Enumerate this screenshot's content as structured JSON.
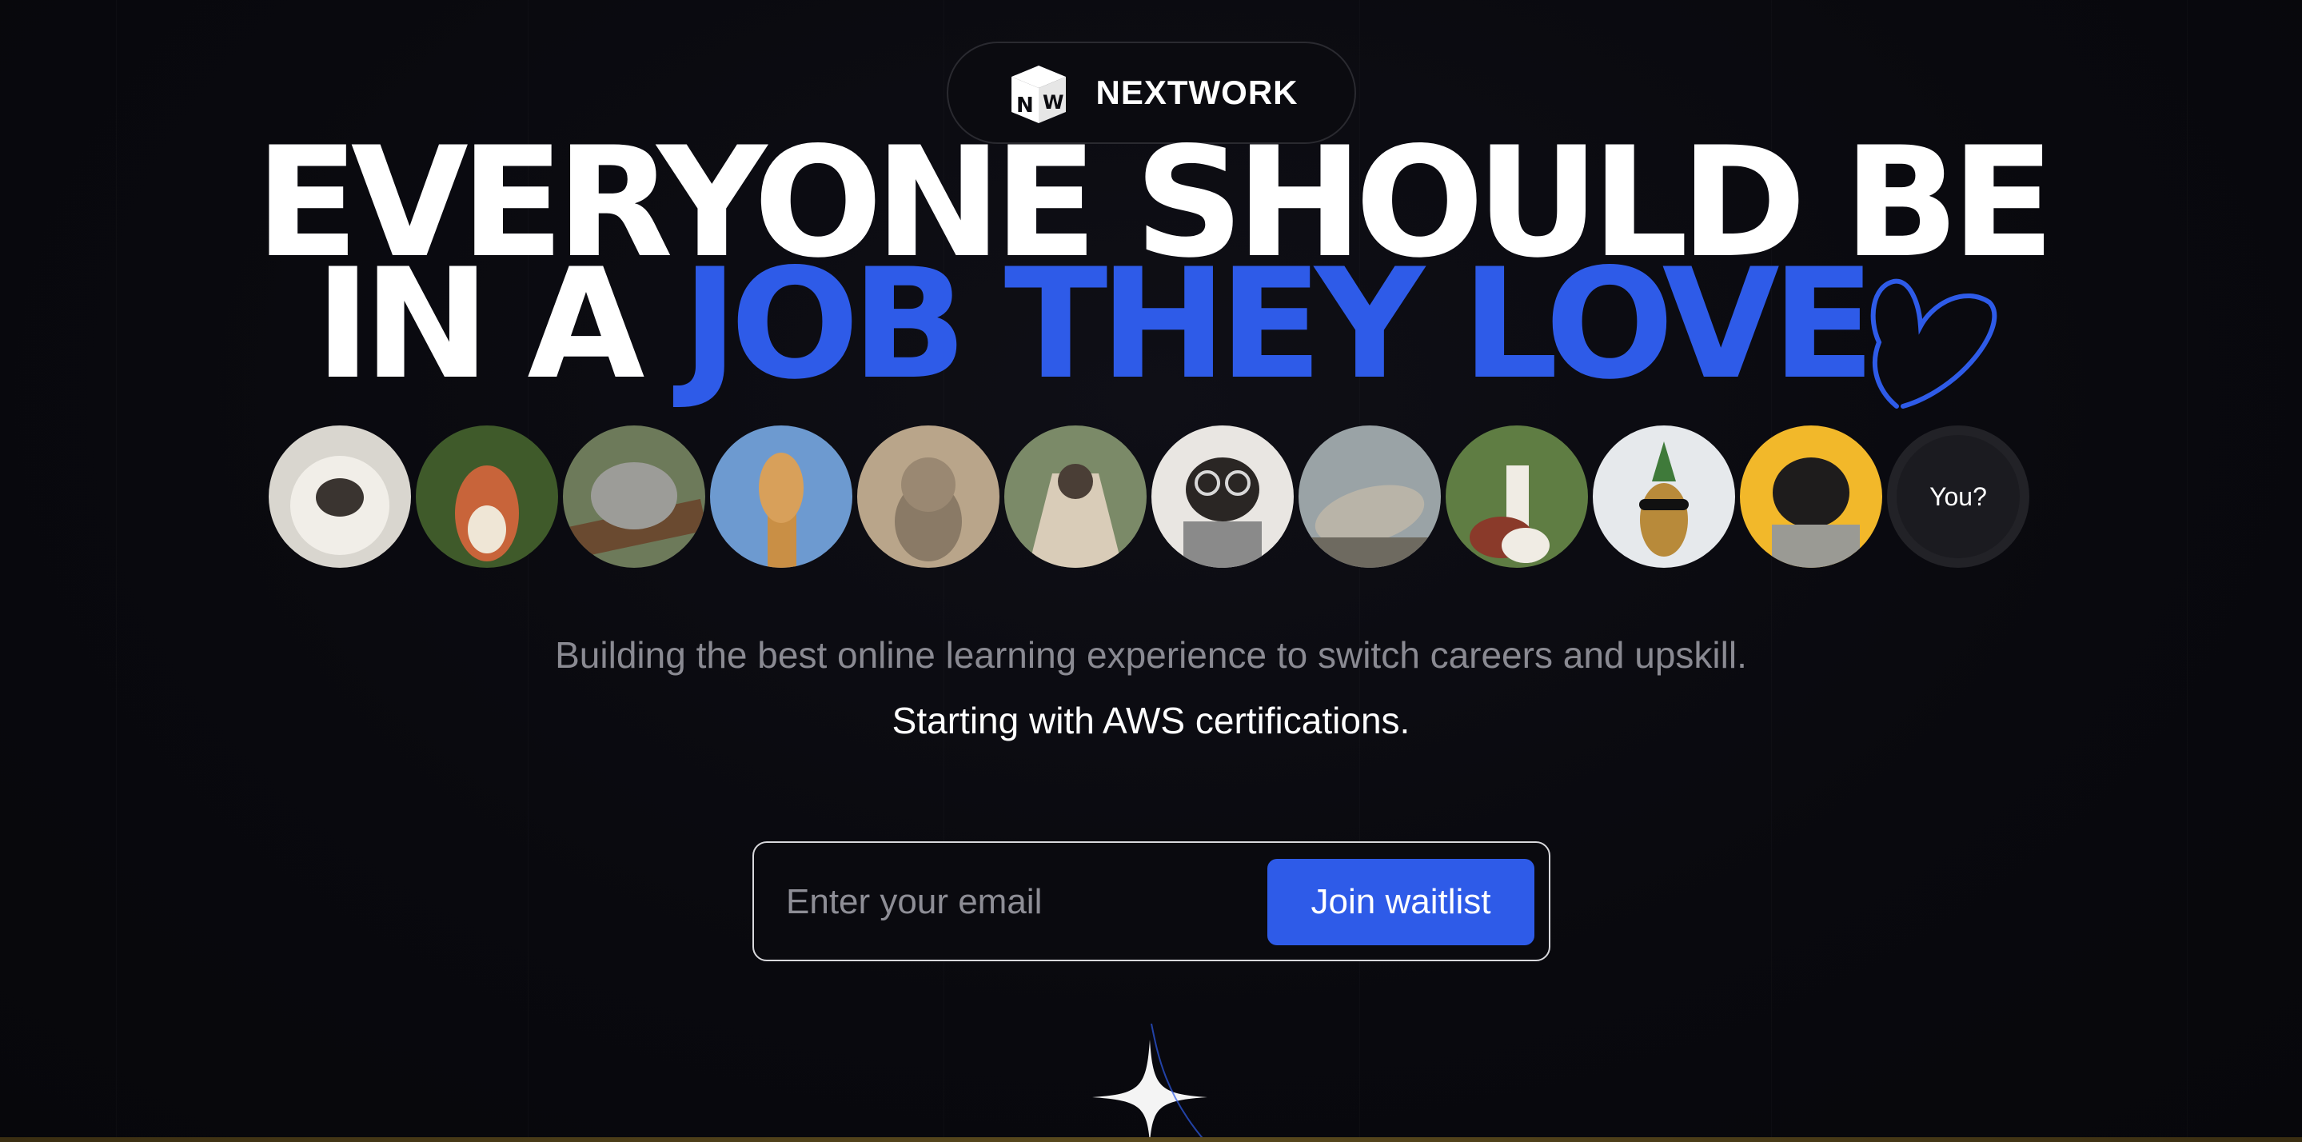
{
  "brand": {
    "name": "NEXTWORK",
    "logo_letters": [
      "N",
      "W"
    ]
  },
  "headline": {
    "line1": "EVERYONE SHOULD BE",
    "line2_prefix": "IN A ",
    "line2_accent": "JOB THEY LOVE"
  },
  "avatars": {
    "items": [
      {
        "icon": "fluffy-pug-photo",
        "bg": "#d9d6cf"
      },
      {
        "icon": "squirrel-photo",
        "bg": "#3f5a2a"
      },
      {
        "icon": "koala-photo",
        "bg": "#6d7a5a"
      },
      {
        "icon": "giraffe-photo",
        "bg": "#6d9ad0"
      },
      {
        "icon": "kitten-photo",
        "bg": "#b9a58a"
      },
      {
        "icon": "pug-blanket-photo",
        "bg": "#7b8a68"
      },
      {
        "icon": "pug-glasses-photo",
        "bg": "#e9e6e2"
      },
      {
        "icon": "seal-photo",
        "bg": "#9aa3a6"
      },
      {
        "icon": "alpaca-photo",
        "bg": "#5f7d43"
      },
      {
        "icon": "pineapple-sunglasses-photo",
        "bg": "#e6e9ec"
      },
      {
        "icon": "pug-yellow-photo",
        "bg": "#f2b82a"
      }
    ],
    "you_label": "You?"
  },
  "tagline": "Building the best online learning experience to switch careers and upskill.",
  "subline": "Starting with AWS certifications.",
  "form": {
    "email_placeholder": "Enter your email",
    "email_value": "",
    "submit_label": "Join waitlist"
  },
  "colors": {
    "background": "#08080d",
    "accent": "#2e5be8",
    "text": "#ffffff",
    "muted": "#8a8a92"
  }
}
